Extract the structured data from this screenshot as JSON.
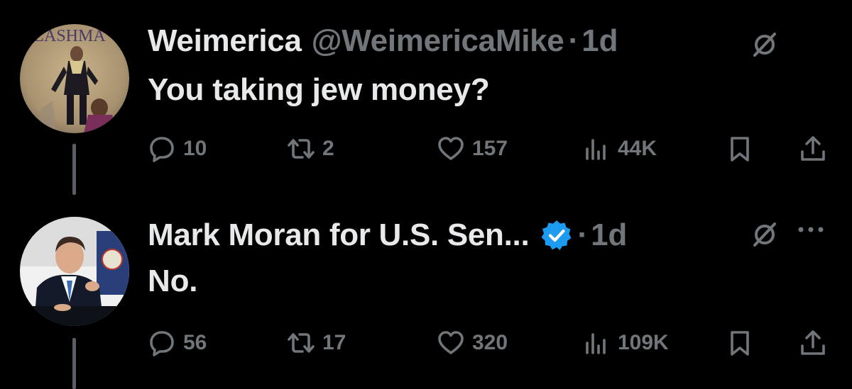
{
  "colors": {
    "background": "#000000",
    "primary_text": "#e7e9ea",
    "secondary_text": "#71767b",
    "verified": "#1d9bf0",
    "thread_line": "#5b5f63"
  },
  "tweets": [
    {
      "display_name": "Weimerica",
      "handle": "@WeimericaMike",
      "separator": "·",
      "time": "1d",
      "text": "You taking jew money?",
      "avatar_text": "LASHMA",
      "counts": {
        "replies": "10",
        "retweets": "2",
        "likes": "157",
        "views": "44K"
      }
    },
    {
      "display_name": "Mark Moran for U.S. Sen...",
      "separator": "·",
      "time": "1d",
      "verified": true,
      "text": "No.",
      "counts": {
        "replies": "56",
        "retweets": "17",
        "likes": "320",
        "views": "109K"
      }
    }
  ]
}
